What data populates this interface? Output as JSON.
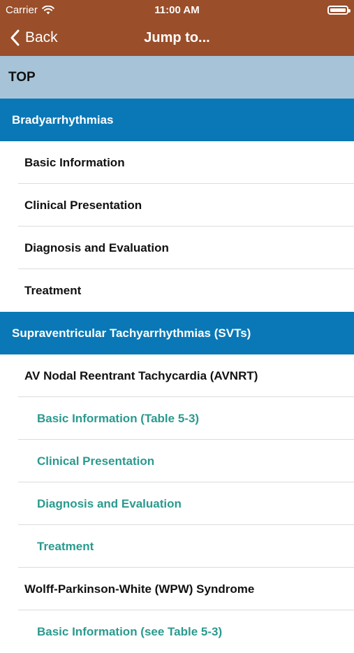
{
  "status": {
    "carrier": "Carrier",
    "time": "11:00 AM"
  },
  "nav": {
    "back_label": "Back",
    "title": "Jump to..."
  },
  "list": {
    "top_label": "TOP",
    "sections": [
      {
        "title": "Bradyarrhythmias",
        "items": [
          {
            "label": "Basic Information"
          },
          {
            "label": "Clinical Presentation"
          },
          {
            "label": "Diagnosis and Evaluation"
          },
          {
            "label": "Treatment"
          }
        ]
      },
      {
        "title": "Supraventricular Tachyarrhythmias (SVTs)",
        "items": [
          {
            "label": "AV Nodal Reentrant Tachycardia (AVNRT)"
          },
          {
            "label": "Basic Information (Table 5-3)"
          },
          {
            "label": "Clinical Presentation"
          },
          {
            "label": "Diagnosis and Evaluation"
          },
          {
            "label": "Treatment"
          },
          {
            "label": "Wolff-Parkinson-White (WPW) Syndrome"
          },
          {
            "label": "Basic Information (see Table 5-3)"
          }
        ]
      }
    ]
  }
}
